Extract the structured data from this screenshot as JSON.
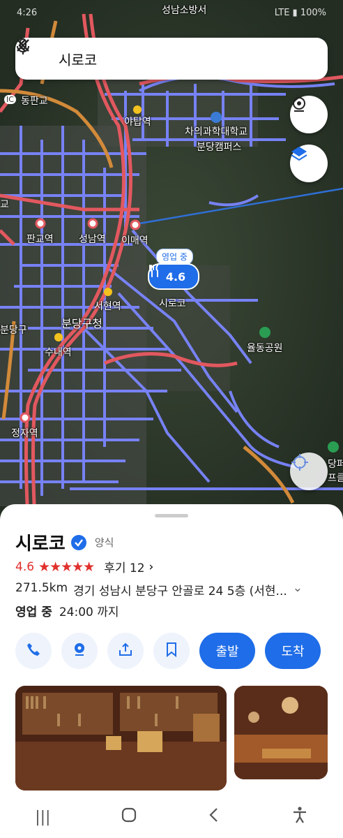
{
  "status": {
    "time": "4:26",
    "net": "LTE",
    "battery": "100%"
  },
  "search": {
    "query": "시로코"
  },
  "map_labels": {
    "seongnam_fire": "성남소방서",
    "dongpangyo": "동판교",
    "ic": "IC",
    "yatap": "야탑역",
    "cha_univ": "차의과학대학교",
    "bundang_campus": "분당캠퍼스",
    "pangyo": "판교역",
    "seongnam": "성남역",
    "imae": "이매역",
    "seohyeon": "서현역",
    "bundang_gu_office": "분당구청",
    "sunae": "수내역",
    "jeongja": "정자역",
    "yuldong_park": "율동공원",
    "place_label": "시로코",
    "gyo": "교",
    "bundang_gu": "분당구",
    "bundang_peul": "당퍼플",
    "peu": "프클"
  },
  "pin": {
    "tag": "영업 중",
    "rating": "4.6"
  },
  "place": {
    "name": "시로코",
    "category": "양식",
    "rating": "4.6",
    "stars": "★★★★★",
    "reviews": "후기 12",
    "distance": "271.5km",
    "address": "경기 성남시 분당구 안골로 24 5층 (서현...",
    "status": "영업 중",
    "hours": "24:00 까지"
  },
  "actions": {
    "depart": "출발",
    "arrive": "도착"
  },
  "colors": {
    "accent": "#1f6de8",
    "star": "#e0302c"
  }
}
